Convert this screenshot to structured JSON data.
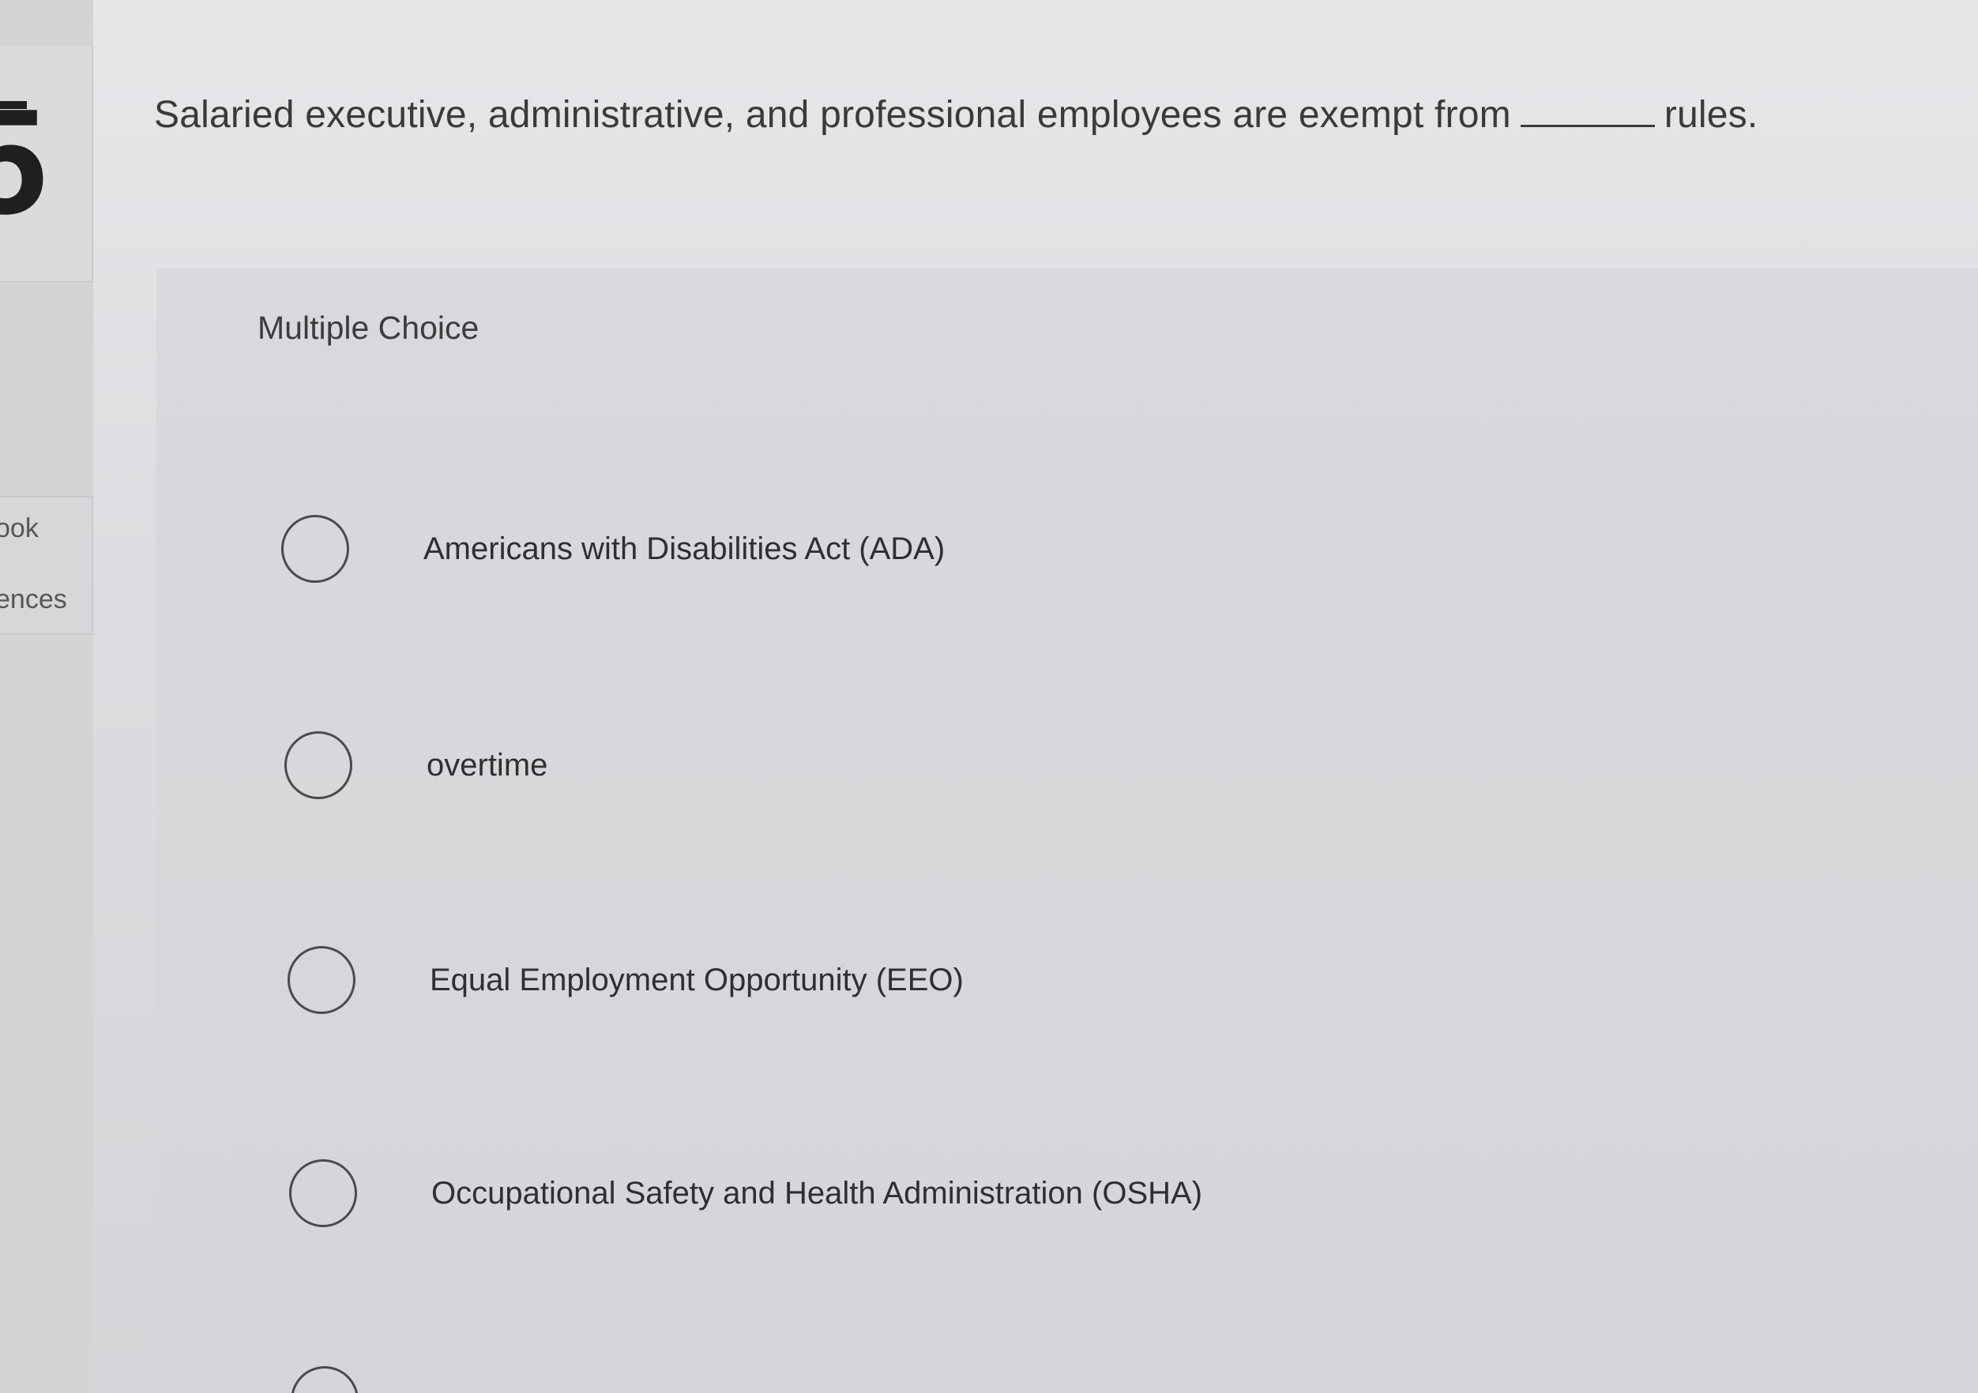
{
  "question": {
    "number": "5",
    "text_before_blank": "Salaried executive, administrative, and professional employees are exempt from",
    "text_after_blank": "rules."
  },
  "sidebar": {
    "links": [
      {
        "label": "ook"
      },
      {
        "label": "ences"
      }
    ]
  },
  "answers": {
    "heading": "Multiple Choice",
    "options": [
      {
        "label": "Americans with Disabilities Act (ADA)",
        "selected": false
      },
      {
        "label": "overtime",
        "selected": false
      },
      {
        "label": "Equal Employment Opportunity (EEO)",
        "selected": false
      },
      {
        "label": "Occupational Safety and Health Administration (OSHA)",
        "selected": false
      },
      {
        "label": "",
        "selected": false
      }
    ]
  }
}
